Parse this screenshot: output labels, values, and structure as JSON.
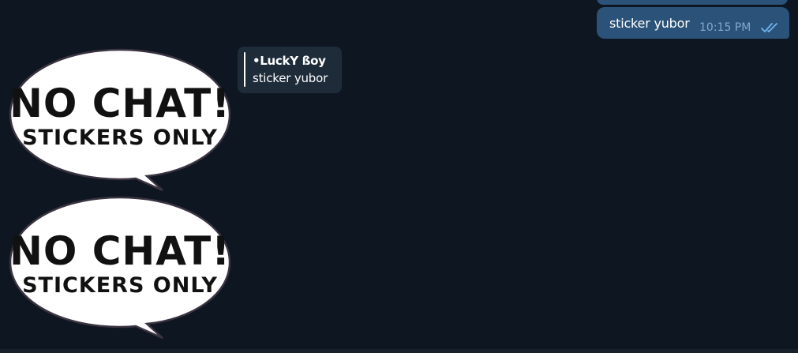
{
  "outgoing_message": {
    "text": "sticker yubor",
    "time": "10:15 PM",
    "status_icon": "double-check-icon"
  },
  "stickers": [
    {
      "line1": "NO CHAT!",
      "line2": "STICKERS ONLY"
    },
    {
      "line1": "NO CHAT!",
      "line2": "STICKERS ONLY"
    }
  ],
  "reply": {
    "author": "•LuckY ßoy",
    "text": "sticker yubor"
  },
  "colors": {
    "background": "#0e1621",
    "outgoing_bubble": "#2b5278",
    "reply_box": "#1e2c3a",
    "time_text": "#7ea9d1"
  }
}
